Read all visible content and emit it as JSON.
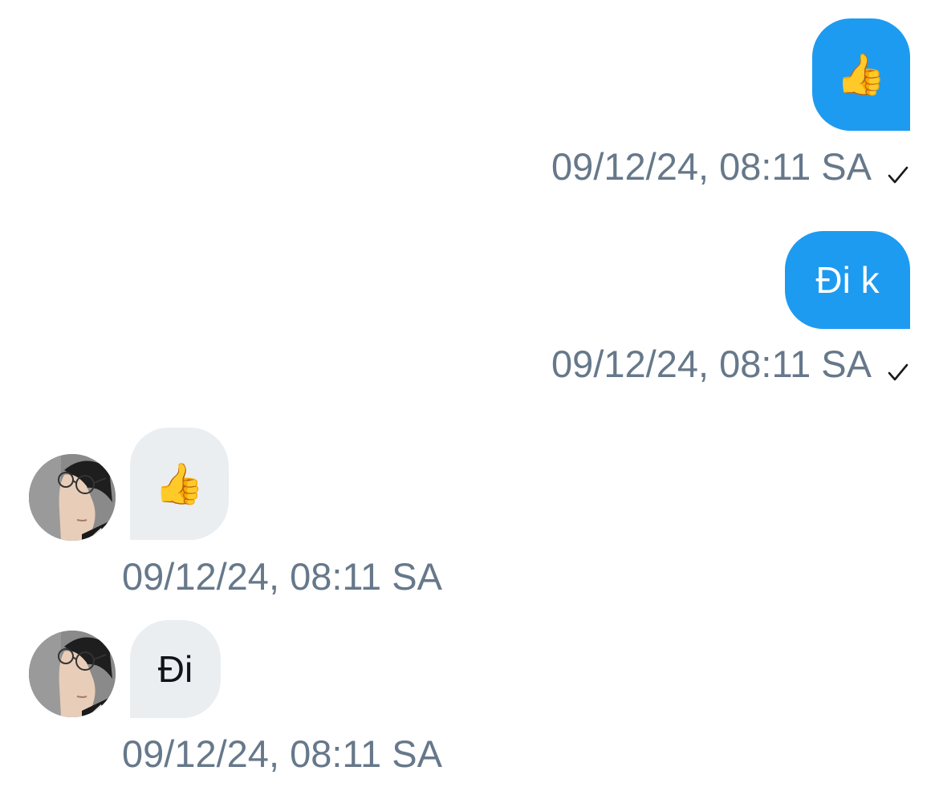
{
  "messages": [
    {
      "direction": "outgoing",
      "text": "👍",
      "timestamp": "09/12/24, 08:11 SA",
      "status": "sent",
      "status_icon": "check-icon"
    },
    {
      "direction": "outgoing",
      "text": "Đi k",
      "timestamp": "09/12/24, 08:11 SA",
      "status": "sent",
      "status_icon": "check-icon"
    },
    {
      "direction": "incoming",
      "text": "👍",
      "timestamp": "09/12/24, 08:11 SA",
      "avatar": "avatar"
    },
    {
      "direction": "incoming",
      "text": "Đi",
      "timestamp": "09/12/24, 08:11 SA",
      "avatar": "avatar"
    }
  ],
  "colors": {
    "outgoing_bubble": "#1d9bf0",
    "outgoing_text": "#ffffff",
    "incoming_bubble": "#eaeef1",
    "incoming_text": "#0f1419",
    "timestamp": "#66788a",
    "check": "#1a1a1a"
  }
}
